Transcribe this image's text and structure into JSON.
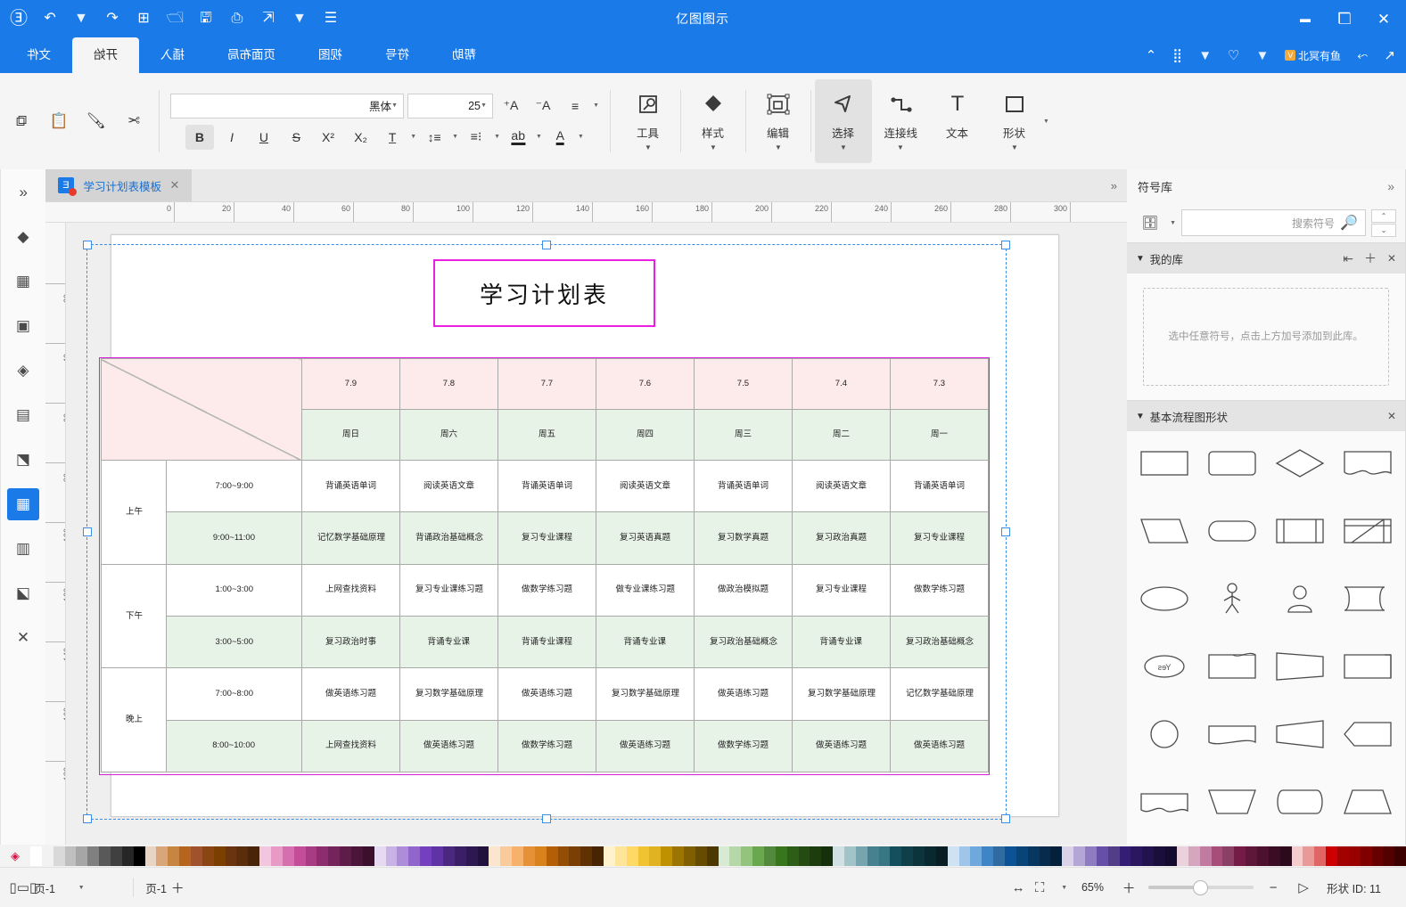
{
  "titlebar": {
    "app_title": "亿图图示",
    "left_icons": [
      "close-icon",
      "restore-icon",
      "minimize-icon"
    ],
    "right_icons": [
      "account-icon",
      "redo-icon",
      "undo-icon",
      "new-icon",
      "open-icon",
      "save-icon",
      "print-icon",
      "share-icon",
      "more-icon"
    ]
  },
  "quickbar": {
    "pointer_icon": "cursor-icon",
    "connector_icon": "connector-icon",
    "user_badge": "V",
    "user_text": "北冥有鱼",
    "shapes_icon": "shapes-icon",
    "grid_icon": "grid-icon",
    "up_icon": "chevron-up-icon"
  },
  "ribbon_tabs": [
    {
      "label": "文件",
      "active": false
    },
    {
      "label": "开始",
      "active": true
    },
    {
      "label": "插入",
      "active": false
    },
    {
      "label": "页面布局",
      "active": false
    },
    {
      "label": "视图",
      "active": false
    },
    {
      "label": "符号",
      "active": false
    },
    {
      "label": "帮助",
      "active": false
    }
  ],
  "ribbon": {
    "clipboard": [
      {
        "name": "copy-button",
        "icon": "copy-icon"
      },
      {
        "name": "paste-button",
        "icon": "paste-icon"
      },
      {
        "name": "format-painter-button",
        "icon": "brush-icon"
      },
      {
        "name": "cut-button",
        "icon": "scissors-icon"
      }
    ],
    "font": {
      "family": "黑体",
      "size": "25",
      "grow_icon": "font-grow-icon",
      "shrink_icon": "font-shrink-icon",
      "align_icon": "align-icon",
      "bold_label": "B",
      "italic_label": "I",
      "underline_label": "U",
      "strike_label": "S",
      "superscript_label": "X²",
      "subscript_label": "X₂",
      "clear_format_icon": "clear-format-icon",
      "line_spacing_icon": "line-spacing-icon",
      "list_icon": "list-icon",
      "highlight_icon": "highlight-icon",
      "font-color_icon": "font-color-icon"
    },
    "tools": [
      {
        "label": "形状",
        "icon": "square-icon",
        "active": false,
        "has_arrow": true
      },
      {
        "label": "文本",
        "icon": "text-icon",
        "active": false,
        "has_arrow": false
      },
      {
        "label": "连接线",
        "icon": "connector-line-icon",
        "active": false,
        "has_arrow": true
      },
      {
        "label": "选择",
        "icon": "pointer-icon",
        "active": true,
        "has_arrow": true
      },
      {
        "label": "编辑",
        "icon": "edit-shape-icon",
        "active": false,
        "has_arrow": true
      },
      {
        "label": "样式",
        "icon": "fill-icon",
        "active": false,
        "has_arrow": true
      },
      {
        "label": "工具",
        "icon": "tools-icon",
        "active": false,
        "has_arrow": true
      }
    ]
  },
  "vertical_toolbar": [
    {
      "name": "expand-panel-icon",
      "glyph": "»",
      "selected": false
    },
    {
      "name": "fill-icon",
      "glyph": "◆",
      "selected": false
    },
    {
      "name": "theme-icon",
      "glyph": "▦",
      "selected": false
    },
    {
      "name": "image-icon",
      "glyph": "▣",
      "selected": false
    },
    {
      "name": "layers-icon",
      "glyph": "◈",
      "selected": false
    },
    {
      "name": "note-icon",
      "glyph": "▤",
      "selected": false
    },
    {
      "name": "shape-edit-icon",
      "glyph": "◩",
      "selected": false
    },
    {
      "name": "table-icon",
      "glyph": "▦",
      "selected": true
    },
    {
      "name": "chart-icon",
      "glyph": "▥",
      "selected": false
    },
    {
      "name": "container-icon",
      "glyph": "◪",
      "selected": false
    },
    {
      "name": "connector-tool-icon",
      "glyph": "✕",
      "selected": false
    }
  ],
  "doc_tab": {
    "label": "学习计划表模板",
    "favicon": "edraw-icon",
    "close_icon": "close-icon",
    "expander_icon": "chevron-left-icon"
  },
  "rulers": {
    "horizontal": [
      "0",
      "20",
      "40",
      "60",
      "80",
      "100",
      "120",
      "140",
      "160",
      "180",
      "200",
      "220",
      "240",
      "260",
      "280",
      "300"
    ],
    "vertical": [
      "20",
      "40",
      "60",
      "80",
      "100",
      "120",
      "140",
      "160",
      "180"
    ]
  },
  "canvas": {
    "title_shape": "学习计划表",
    "table": {
      "corner": "",
      "dates": [
        "7.3",
        "7.4",
        "7.5",
        "7.6",
        "7.7",
        "7.8",
        "7.9"
      ],
      "days": [
        "周一",
        "周二",
        "周三",
        "周四",
        "周五",
        "周六",
        "周日"
      ],
      "periods": [
        {
          "name": "上午",
          "slots": [
            "7:00~9:00",
            "9:00~11:00"
          ]
        },
        {
          "name": "下午",
          "slots": [
            "1:00~3:00",
            "3:00~5:00"
          ]
        },
        {
          "name": "晚上",
          "slots": [
            "7:00~8:00",
            "8:00~10:00"
          ]
        }
      ],
      "rows": [
        [
          "背诵英语单词",
          "阅读英语文章",
          "背诵英语单词",
          "阅读英语文章",
          "背诵英语单词",
          "阅读英语文章",
          "背诵英语单词"
        ],
        [
          "复习专业课程",
          "复习政治真题",
          "复习数学真题",
          "复习英语真题",
          "复习专业课程",
          "背诵政治基础概念",
          "记忆数学基础原理"
        ],
        [
          "做数学练习题",
          "复习专业课程",
          "做政治模拟题",
          "做专业课练习题",
          "做数学练习题",
          "复习专业课练习题",
          "上网查找资料"
        ],
        [
          "复习政治基础概念",
          "背诵专业课",
          "复习政治基础概念",
          "背诵专业课",
          "背诵专业课程",
          "背诵专业课",
          "复习政治时事"
        ],
        [
          "记忆数学基础原理",
          "复习数学基础原理",
          "做英语练习题",
          "复习数学基础原理",
          "做英语练习题",
          "复习数学基础原理",
          "做英语练习题"
        ],
        [
          "做英语练习题",
          "做英语练习题",
          "做数学练习题",
          "做英语练习题",
          "做数学练习题",
          "做英语练习题",
          "上网查找资料"
        ]
      ]
    }
  },
  "symbol_panel": {
    "title": "符号库",
    "collapse_icon": "chevron-right-icon",
    "library_icon": "library-icon",
    "search_placeholder": "搜索符号",
    "search_icon": "search-icon",
    "nav_prev_icon": "chevron-up-icon",
    "nav_next_icon": "chevron-down-icon",
    "groups": [
      {
        "title": "我的库",
        "collapse_icon": "chevron-down-icon",
        "actions": [
          "import-icon",
          "add-icon",
          "close-icon"
        ],
        "empty_text": "选中任意符号，点击上方加号添加到此库。"
      },
      {
        "title": "基本流程图形状",
        "collapse_icon": "chevron-down-icon",
        "actions": [
          "close-icon"
        ],
        "shapes": [
          "rectangle",
          "rounded-rectangle",
          "diamond",
          "document",
          "parallelogram",
          "rounded-box",
          "predefined-process",
          "internal-storage",
          "ellipse",
          "actor",
          "circle-person",
          "stored-data",
          "yes-badge",
          "curved-box",
          "trapezoid-box",
          "card",
          "circle",
          "tape",
          "wedge",
          "pentagon-arrow",
          "wave-shape",
          "manual-operation",
          "rounded-trapezoid",
          "trapezoid"
        ]
      }
    ]
  },
  "statusbar": {
    "shape_id_label": "形状 ID: 11",
    "prev_page_icon": "prev-page-icon",
    "zoom_out_icon": "minus-icon",
    "zoom_in_icon": "plus-icon",
    "zoom_level": "65%",
    "zoom_caret": "chevron-down-icon",
    "fit_page_icon": "fit-page-icon",
    "fit_width_icon": "fit-width-icon",
    "page_name": "页-1",
    "add_page_icon": "add-page-icon",
    "page_selector": "页-1",
    "page_selector_caret": "chevron-down-icon",
    "view_mode_icon": "view-mode-icon"
  },
  "palette": {
    "eyedropper_icon": "eyedropper-icon",
    "colors": [
      "#ffffff",
      "#f2f2f2",
      "#d9d9d9",
      "#bfbfbf",
      "#a6a6a6",
      "#808080",
      "#595959",
      "#404040",
      "#262626",
      "#000000",
      "#e8d4c3",
      "#d9a679",
      "#c68642",
      "#b5651d",
      "#a0522d",
      "#8b4513",
      "#7b3f00",
      "#6b3410",
      "#5a2d0c",
      "#4a2409",
      "#f2c6de",
      "#e89ac7",
      "#d66fb0",
      "#c44d9a",
      "#a83b82",
      "#8e2d6e",
      "#74245a",
      "#5e1c49",
      "#4a1539",
      "#3a102c",
      "#e6d9f2",
      "#c9b3e6",
      "#ad8cd9",
      "#9166cc",
      "#7540bf",
      "#5f33a6",
      "#4a2880",
      "#3a1f66",
      "#2d1852",
      "#21113d",
      "#fce5cd",
      "#f9cb9c",
      "#f6b26b",
      "#e69138",
      "#d9821c",
      "#b45f06",
      "#944d05",
      "#7a3f04",
      "#5f3103",
      "#472502",
      "#fff2cc",
      "#ffe599",
      "#ffd966",
      "#f1c232",
      "#e0b420",
      "#bf9000",
      "#9c7500",
      "#7f5f00",
      "#664c00",
      "#4d3900",
      "#d9ead3",
      "#b6d7a8",
      "#93c47d",
      "#6aa84f",
      "#53893d",
      "#38761d",
      "#2d5e17",
      "#244c12",
      "#1d3d0e",
      "#16300b",
      "#d0e0e3",
      "#a2c4c9",
      "#76a5af",
      "#45818e",
      "#377782",
      "#134f5c",
      "#0f404a",
      "#0c343d",
      "#09282f",
      "#071f24",
      "#cfe2f3",
      "#9fc5e8",
      "#6fa8dc",
      "#3d85c6",
      "#2f6aa0",
      "#0b5394",
      "#094478",
      "#073660",
      "#062b4d",
      "#04213b",
      "#d9d2e9",
      "#b4a7d6",
      "#8e7cc3",
      "#674ea7",
      "#523e86",
      "#351c75",
      "#2b1760",
      "#22124d",
      "#1a0e3b",
      "#140b2e",
      "#ead1dc",
      "#d5a6bd",
      "#c27ba0",
      "#a64d79",
      "#8a3f64",
      "#741b47",
      "#5e1639",
      "#4b112e",
      "#3a0d24",
      "#2c0a1b",
      "#f4cccc",
      "#ea9999",
      "#e06666",
      "#cc0000",
      "#a30000",
      "#990000",
      "#800000",
      "#660000",
      "#520000",
      "#3d0000"
    ]
  }
}
